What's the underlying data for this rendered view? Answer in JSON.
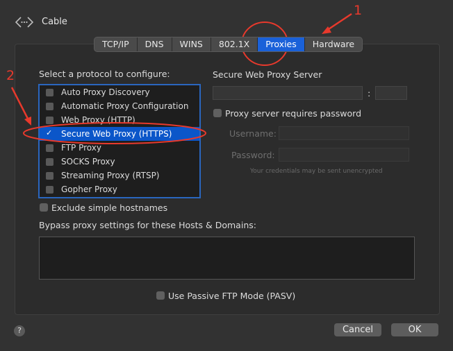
{
  "window": {
    "title": "Cable"
  },
  "tabs": [
    {
      "label": "TCP/IP",
      "active": false
    },
    {
      "label": "DNS",
      "active": false
    },
    {
      "label": "WINS",
      "active": false
    },
    {
      "label": "802.1X",
      "active": false
    },
    {
      "label": "Proxies",
      "active": true
    },
    {
      "label": "Hardware",
      "active": false
    }
  ],
  "protocols": {
    "heading": "Select a protocol to configure:",
    "items": [
      {
        "label": "Auto Proxy Discovery",
        "checked": false
      },
      {
        "label": "Automatic Proxy Configuration",
        "checked": false
      },
      {
        "label": "Web Proxy (HTTP)",
        "checked": false
      },
      {
        "label": "Secure Web Proxy (HTTPS)",
        "checked": true
      },
      {
        "label": "FTP Proxy",
        "checked": false
      },
      {
        "label": "SOCKS Proxy",
        "checked": false
      },
      {
        "label": "Streaming Proxy (RTSP)",
        "checked": false
      },
      {
        "label": "Gopher Proxy",
        "checked": false
      }
    ]
  },
  "server": {
    "heading": "Secure Web Proxy Server",
    "host_value": "",
    "colon": ":",
    "port_value": "",
    "requires_password_label": "Proxy server requires password",
    "username_label": "Username:",
    "password_label": "Password:",
    "note": "Your credentials may be sent unencrypted"
  },
  "options": {
    "exclude_simple_label": "Exclude simple hostnames",
    "bypass_label": "Bypass proxy settings for these Hosts & Domains:",
    "bypass_value": "",
    "passive_ftp_label": "Use Passive FTP Mode (PASV)"
  },
  "footer": {
    "help": "?",
    "cancel": "Cancel",
    "ok": "OK"
  },
  "annotations": {
    "step1": "1",
    "step2": "2",
    "color": "#e8392c"
  },
  "colors": {
    "accent": "#1a61d9",
    "selection": "#0b56c9",
    "list_border": "#2a66bf"
  }
}
